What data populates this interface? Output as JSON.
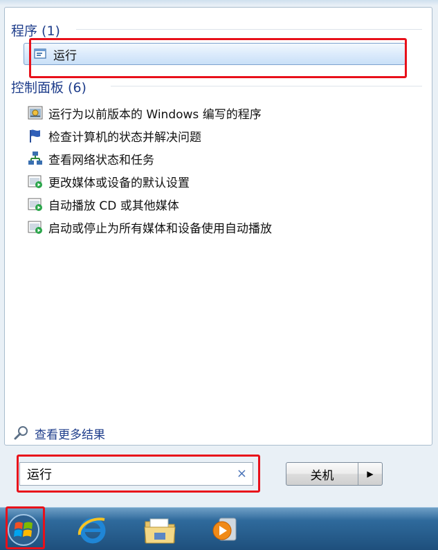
{
  "groups": {
    "programs_header": "程序 (1)",
    "control_panel_header": "控制面板 (6)"
  },
  "programs": [
    {
      "label": "运行",
      "icon": "run-icon"
    }
  ],
  "control_panel_items": [
    {
      "label": "运行为以前版本的 Windows 编写的程序",
      "icon": "compatibility-icon"
    },
    {
      "label": "检查计算机的状态并解决问题",
      "icon": "action-center-flag-icon"
    },
    {
      "label": "查看网络状态和任务",
      "icon": "network-icon"
    },
    {
      "label": "更改媒体或设备的默认设置",
      "icon": "autoplay-icon"
    },
    {
      "label": "自动播放 CD 或其他媒体",
      "icon": "autoplay-icon"
    },
    {
      "label": "启动或停止为所有媒体和设备使用自动播放",
      "icon": "autoplay-icon"
    }
  ],
  "see_more": "查看更多结果",
  "search": {
    "value": "运行",
    "clear_glyph": "×"
  },
  "shutdown": {
    "label": "关机",
    "arrow": "▶"
  },
  "colors": {
    "highlight": "#e8101a",
    "header_text": "#1e3d8b",
    "taskbar": "#1e4f7c"
  }
}
